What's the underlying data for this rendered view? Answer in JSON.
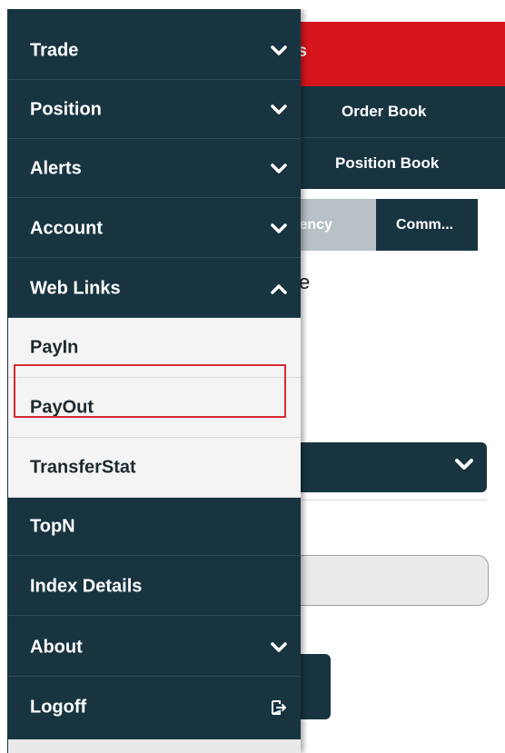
{
  "background": {
    "header_title_partial": "ts",
    "tab_row1": "Order Book",
    "tab_row2": "Position Book",
    "segment_left": "rrency",
    "segment_right": "Comm...",
    "partial_text": "e"
  },
  "menu": {
    "trade": "Trade",
    "position": "Position",
    "alerts": "Alerts",
    "account": "Account",
    "web_links": "Web Links",
    "web_links_sub": {
      "payin": "PayIn",
      "payout": "PayOut",
      "transferstat": "TransferStat"
    },
    "topn": "TopN",
    "index_details": "Index Details",
    "about": "About",
    "logoff": "Logoff"
  },
  "colors": {
    "drawer": "#183440",
    "header": "#d7161c",
    "highlight": "#d62a36"
  }
}
